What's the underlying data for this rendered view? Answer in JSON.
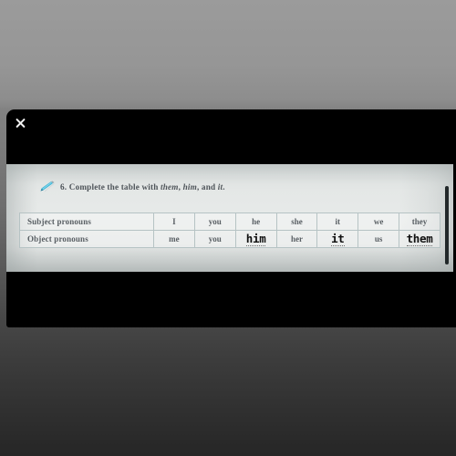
{
  "viewer": {
    "close_label": "Close",
    "close_icon": "close-icon",
    "background_top_color": "#9b9b9b",
    "background_bottom_color": "#262626",
    "panel_color": "#000000"
  },
  "scrollbar": {
    "name": "vertical-scrollbar",
    "thumb_color": "#22282a"
  },
  "worksheet": {
    "icon": "pencil-icon",
    "instruction": {
      "number": "6.",
      "lead": "Complete the table with",
      "word_1": "them",
      "sep_1": ",",
      "word_2": "him",
      "sep_2": ", and",
      "word_3": "it",
      "end": "."
    },
    "table": {
      "rows": [
        {
          "label": "Subject pronouns",
          "cells": [
            {
              "text": "I",
              "handwritten": false
            },
            {
              "text": "you",
              "handwritten": false
            },
            {
              "text": "he",
              "handwritten": false
            },
            {
              "text": "she",
              "handwritten": false
            },
            {
              "text": "it",
              "handwritten": false
            },
            {
              "text": "we",
              "handwritten": false
            },
            {
              "text": "they",
              "handwritten": false
            }
          ]
        },
        {
          "label": "Object pronouns",
          "cells": [
            {
              "text": "me",
              "handwritten": false
            },
            {
              "text": "you",
              "handwritten": false
            },
            {
              "text": "him",
              "handwritten": true
            },
            {
              "text": "her",
              "handwritten": false
            },
            {
              "text": "it",
              "handwritten": true
            },
            {
              "text": "us",
              "handwritten": false
            },
            {
              "text": "them",
              "handwritten": true
            }
          ]
        }
      ]
    }
  }
}
